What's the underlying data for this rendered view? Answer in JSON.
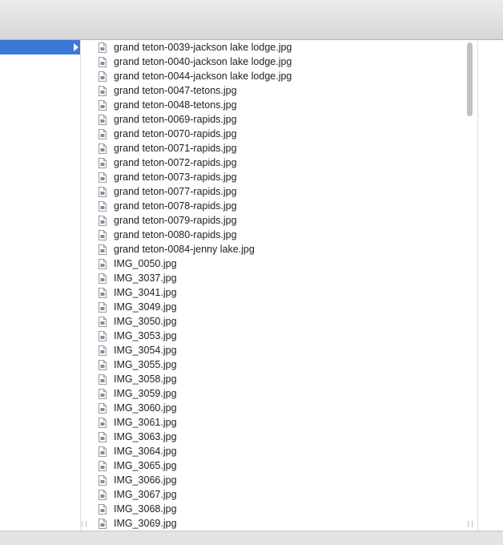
{
  "colors": {
    "selection": "#3c78d8",
    "toolbar": "#dcdcdc",
    "text": "#1e1e1e"
  },
  "icons": {
    "file": "jpeg-file-icon",
    "arrow": "disclosure-arrow-right-icon"
  },
  "files": [
    "grand teton-0039-jackson lake lodge.jpg",
    "grand teton-0040-jackson lake lodge.jpg",
    "grand teton-0044-jackson lake lodge.jpg",
    "grand teton-0047-tetons.jpg",
    "grand teton-0048-tetons.jpg",
    "grand teton-0069-rapids.jpg",
    "grand teton-0070-rapids.jpg",
    "grand teton-0071-rapids.jpg",
    "grand teton-0072-rapids.jpg",
    "grand teton-0073-rapids.jpg",
    "grand teton-0077-rapids.jpg",
    "grand teton-0078-rapids.jpg",
    "grand teton-0079-rapids.jpg",
    "grand teton-0080-rapids.jpg",
    "grand teton-0084-jenny lake.jpg",
    "IMG_0050.jpg",
    "IMG_3037.jpg",
    "IMG_3041.jpg",
    "IMG_3049.jpg",
    "IMG_3050.jpg",
    "IMG_3053.jpg",
    "IMG_3054.jpg",
    "IMG_3055.jpg",
    "IMG_3058.jpg",
    "IMG_3059.jpg",
    "IMG_3060.jpg",
    "IMG_3061.jpg",
    "IMG_3063.jpg",
    "IMG_3064.jpg",
    "IMG_3065.jpg",
    "IMG_3066.jpg",
    "IMG_3067.jpg",
    "IMG_3068.jpg",
    "IMG_3069.jpg"
  ]
}
